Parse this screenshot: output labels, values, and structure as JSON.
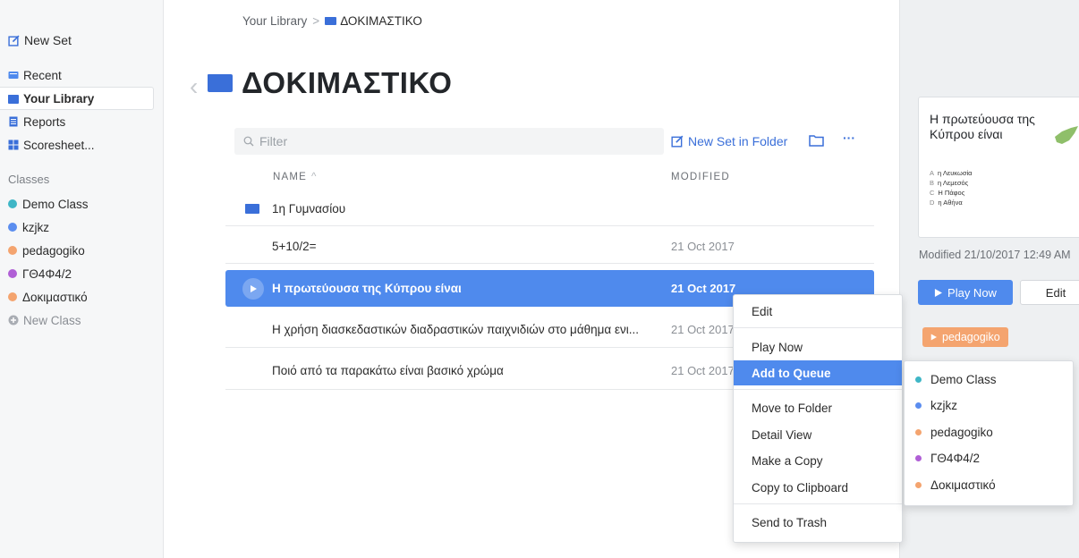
{
  "sidebar": {
    "new_set": "New Set",
    "nav": [
      {
        "label": "Recent"
      },
      {
        "label": "Your Library"
      },
      {
        "label": "Reports"
      },
      {
        "label": "Scoresheet..."
      }
    ],
    "classes_header": "Classes",
    "classes": [
      {
        "label": "Demo Class",
        "color": "#3fb6c6"
      },
      {
        "label": "kzjkz",
        "color": "#5b8def"
      },
      {
        "label": "pedagogiko",
        "color": "#f4a46f"
      },
      {
        "label": "ΓΘ4Φ4/2",
        "color": "#b05fd6"
      },
      {
        "label": "Δοκιμαστικό",
        "color": "#f4a46f"
      }
    ],
    "new_class": "New Class"
  },
  "breadcrumb": {
    "root": "Your Library",
    "separator": ">",
    "current": "ΔΟΚΙΜΑΣΤΙΚΟ"
  },
  "page": {
    "title": "ΔΟΚΙΜΑΣΤΙΚΟ"
  },
  "toolbar": {
    "filter_placeholder": "Filter",
    "new_set_in_folder": "New Set in Folder",
    "more": "···"
  },
  "table": {
    "columns": {
      "name": "NAME",
      "modified": "MODIFIED"
    },
    "rows": [
      {
        "name": "1η Γυμνασίου",
        "date": ""
      },
      {
        "name": "5+10/2=",
        "date": "21 Oct 2017"
      },
      {
        "name": "Η πρωτεύουσα της Κύπρου είναι",
        "date": "21 Oct 2017"
      },
      {
        "name": "Η χρήση διασκεδαστικών διαδραστικών παιχνιδιών στο μάθημα ενι...",
        "date": "21 Oct 2017"
      },
      {
        "name": "Ποιό από τα παρακάτω είναι βασικό χρώμα",
        "date": "21 Oct 2017"
      }
    ]
  },
  "context_menu": {
    "items": [
      "Edit",
      "Play Now",
      "Add to Queue",
      "Move to Folder",
      "Detail View",
      "Make a Copy",
      "Copy to Clipboard",
      "Send to Trash"
    ]
  },
  "submenu": {
    "items": [
      {
        "label": "Demo Class",
        "color": "#3fb6c6"
      },
      {
        "label": "kzjkz",
        "color": "#5b8def"
      },
      {
        "label": "pedagogiko",
        "color": "#f4a46f"
      },
      {
        "label": "ΓΘ4Φ4/2",
        "color": "#b05fd6"
      },
      {
        "label": "Δοκιμαστικό",
        "color": "#f4a46f"
      }
    ]
  },
  "details": {
    "question": "Η πρωτεύουσα της Κύπρου είναι",
    "options": [
      {
        "letter": "A",
        "text": "η Λευκωσία"
      },
      {
        "letter": "B",
        "text": "η Λεμεσός"
      },
      {
        "letter": "C",
        "text": "Η Πάφος"
      },
      {
        "letter": "D",
        "text": "η Αθήνα"
      }
    ],
    "modified": "Modified 21/10/2017 12:49 AM",
    "play_now": "Play Now",
    "edit": "Edit",
    "tag": "pedagogiko"
  },
  "colors": {
    "accent": "#4f8aed",
    "folder": "#3a6fd9"
  }
}
